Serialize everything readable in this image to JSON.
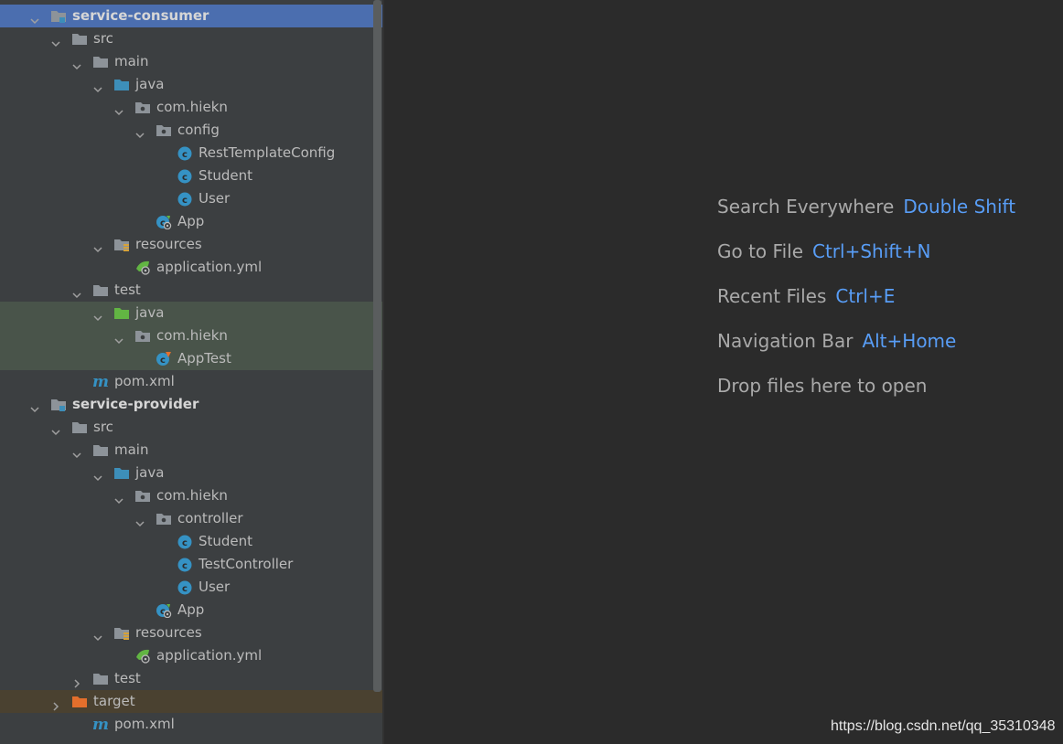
{
  "tree": [
    {
      "label": "service-consumer",
      "level": 0,
      "expander": "open",
      "icon": "module-icon",
      "state": "selected",
      "bold": true
    },
    {
      "label": "src",
      "level": 1,
      "expander": "open",
      "icon": "folder-icon"
    },
    {
      "label": "main",
      "level": 2,
      "expander": "open",
      "icon": "folder-icon"
    },
    {
      "label": "java",
      "level": 3,
      "expander": "open",
      "icon": "source-folder-icon"
    },
    {
      "label": "com.hiekn",
      "level": 4,
      "expander": "open",
      "icon": "package-icon"
    },
    {
      "label": "config",
      "level": 5,
      "expander": "open",
      "icon": "package-icon"
    },
    {
      "label": "RestTemplateConfig",
      "level": 6,
      "expander": "none",
      "icon": "class-icon"
    },
    {
      "label": "Student",
      "level": 6,
      "expander": "none",
      "icon": "class-icon"
    },
    {
      "label": "User",
      "level": 6,
      "expander": "none",
      "icon": "class-icon"
    },
    {
      "label": "App",
      "level": 5,
      "expander": "none",
      "icon": "spring-boot-class-icon"
    },
    {
      "label": "resources",
      "level": 3,
      "expander": "open",
      "icon": "resources-folder-icon"
    },
    {
      "label": "application.yml",
      "level": 4,
      "expander": "none",
      "icon": "spring-config-icon"
    },
    {
      "label": "test",
      "level": 2,
      "expander": "open",
      "icon": "folder-icon"
    },
    {
      "label": "java",
      "level": 3,
      "expander": "open",
      "icon": "test-folder-icon",
      "state": "test"
    },
    {
      "label": "com.hiekn",
      "level": 4,
      "expander": "open",
      "icon": "package-icon",
      "state": "test"
    },
    {
      "label": "AppTest",
      "level": 5,
      "expander": "none",
      "icon": "test-class-icon",
      "state": "test"
    },
    {
      "label": "pom.xml",
      "level": 2,
      "expander": "none",
      "icon": "maven-icon"
    },
    {
      "label": "service-provider",
      "level": 0,
      "expander": "open",
      "icon": "module-icon",
      "bold": true
    },
    {
      "label": "src",
      "level": 1,
      "expander": "open",
      "icon": "folder-icon"
    },
    {
      "label": "main",
      "level": 2,
      "expander": "open",
      "icon": "folder-icon"
    },
    {
      "label": "java",
      "level": 3,
      "expander": "open",
      "icon": "source-folder-icon"
    },
    {
      "label": "com.hiekn",
      "level": 4,
      "expander": "open",
      "icon": "package-icon"
    },
    {
      "label": "controller",
      "level": 5,
      "expander": "open",
      "icon": "package-icon"
    },
    {
      "label": "Student",
      "level": 6,
      "expander": "none",
      "icon": "class-icon"
    },
    {
      "label": "TestController",
      "level": 6,
      "expander": "none",
      "icon": "class-icon"
    },
    {
      "label": "User",
      "level": 6,
      "expander": "none",
      "icon": "class-icon"
    },
    {
      "label": "App",
      "level": 5,
      "expander": "none",
      "icon": "spring-boot-class-icon"
    },
    {
      "label": "resources",
      "level": 3,
      "expander": "open",
      "icon": "resources-folder-icon"
    },
    {
      "label": "application.yml",
      "level": 4,
      "expander": "none",
      "icon": "spring-config-icon"
    },
    {
      "label": "test",
      "level": 2,
      "expander": "closed",
      "icon": "folder-icon"
    },
    {
      "label": "target",
      "level": 1,
      "expander": "closed",
      "icon": "excluded-folder-icon",
      "state": "excluded"
    },
    {
      "label": "pom.xml",
      "level": 2,
      "expander": "none",
      "icon": "maven-icon"
    }
  ],
  "hints": [
    {
      "text": "Search Everywhere",
      "key": "Double Shift"
    },
    {
      "text": "Go to File",
      "key": "Ctrl+Shift+N"
    },
    {
      "text": "Recent Files",
      "key": "Ctrl+E"
    },
    {
      "text": "Navigation Bar",
      "key": "Alt+Home"
    },
    {
      "text": "Drop files here to open",
      "key": ""
    }
  ],
  "watermark": "https://blog.csdn.net/qq_35310348",
  "colors": {
    "panel": "#3c3f41",
    "editor": "#2b2b2b",
    "selection": "#4b6eaf",
    "test_bg": "#49544a",
    "excluded_bg": "#4a4130",
    "key_text": "#589df6",
    "folder": "#8d9399",
    "source_folder": "#3d8eb9",
    "test_folder": "#62b543",
    "excluded_folder": "#e46f2c",
    "class": "#3592c4"
  }
}
